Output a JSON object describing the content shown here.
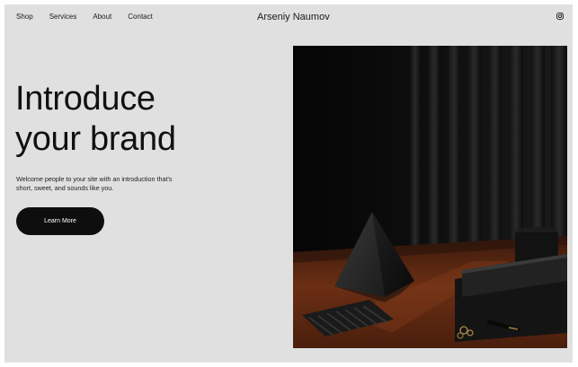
{
  "nav": {
    "links": [
      "Shop",
      "Services",
      "About",
      "Contact"
    ],
    "brand": "Arseniy Naumov",
    "social_icon": "instagram-icon"
  },
  "hero": {
    "title_line1": "Introduce",
    "title_line2": "your brand",
    "body_line1": "Welcome people to your site with an introduction that's",
    "body_line2": "short, sweet, and sounds like you.",
    "cta_label": "Learn More",
    "image": "photo of a dark pyramid sculpture and objects on a wooden table against black vertical slats"
  },
  "colors": {
    "page_background": "#e0e0e0",
    "text": "#111111",
    "button_background": "#0e0e0e",
    "button_text": "#ffffff"
  }
}
